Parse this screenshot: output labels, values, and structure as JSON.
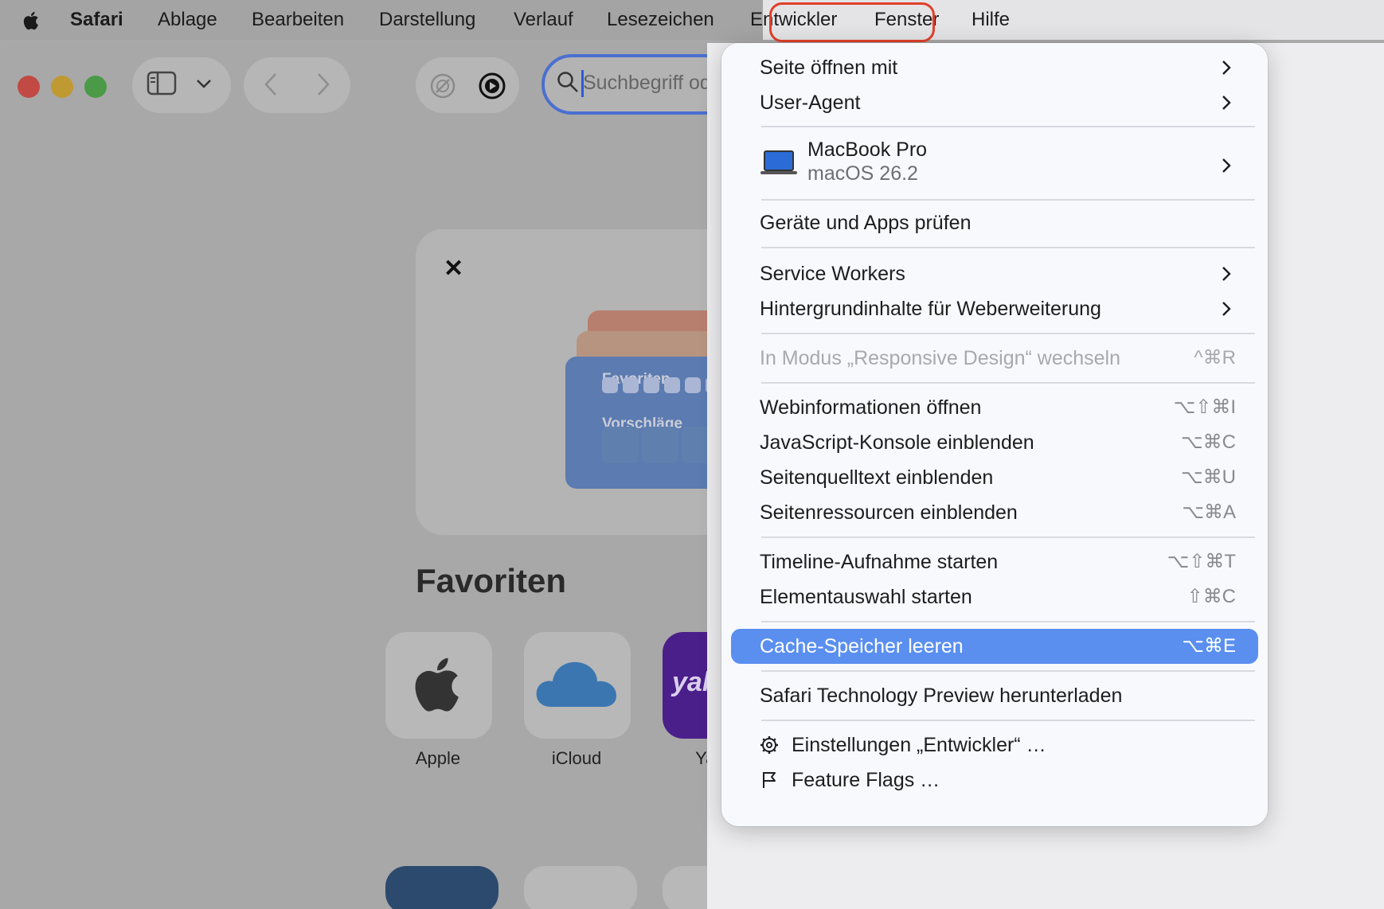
{
  "menubar": {
    "app_name": "Safari",
    "items": [
      "Ablage",
      "Bearbeiten",
      "Darstellung",
      "Verlauf",
      "Lesezeichen",
      "Entwickler",
      "Fenster",
      "Hilfe"
    ],
    "active_item": "Entwickler"
  },
  "toolbar": {
    "search_placeholder": "Suchbegriff ode"
  },
  "promo": {
    "card_favorites": "Favoriten",
    "card_suggestions": "Vorschläge"
  },
  "favorites": {
    "title": "Favoriten",
    "items": [
      {
        "label": "Apple"
      },
      {
        "label": "iCloud"
      },
      {
        "label": "Yaho"
      }
    ],
    "tile_text_yahoo": "yaho"
  },
  "dropdown": {
    "items": {
      "seite_oeffnen": "Seite öffnen mit",
      "user_agent": "User-Agent",
      "device_name": "MacBook Pro",
      "device_os": "macOS 26.2",
      "geraete": "Geräte und Apps prüfen",
      "service_workers": "Service Workers",
      "hintergrund": "Hintergrundinhalte für Weberweiterung",
      "responsive": "In Modus „Responsive Design“ wechseln",
      "responsive_sc": "^⌘R",
      "webinfo": "Webinformationen öffnen",
      "webinfo_sc": "⌥⇧⌘I",
      "js_konsole": "JavaScript-Konsole einblenden",
      "js_konsole_sc": "⌥⌘C",
      "quelltext": "Seitenquelltext einblenden",
      "quelltext_sc": "⌥⌘U",
      "ressourcen": "Seitenressourcen einblenden",
      "ressourcen_sc": "⌥⌘A",
      "timeline": "Timeline-Aufnahme starten",
      "timeline_sc": "⌥⇧⌘T",
      "elementauswahl": "Elementauswahl starten",
      "elementauswahl_sc": "⇧⌘C",
      "cache": "Cache-Speicher leeren",
      "cache_sc": "⌥⌘E",
      "stp": "Safari Technology Preview herunterladen",
      "einstellungen": "Einstellungen „Entwickler“ …",
      "feature_flags": "Feature Flags …"
    },
    "selected_item": "Cache-Speicher leeren"
  },
  "colors": {
    "selection": "#5a8ff0",
    "highlight_ring": "#e0402a",
    "address_focus": "#4a6fd0"
  }
}
